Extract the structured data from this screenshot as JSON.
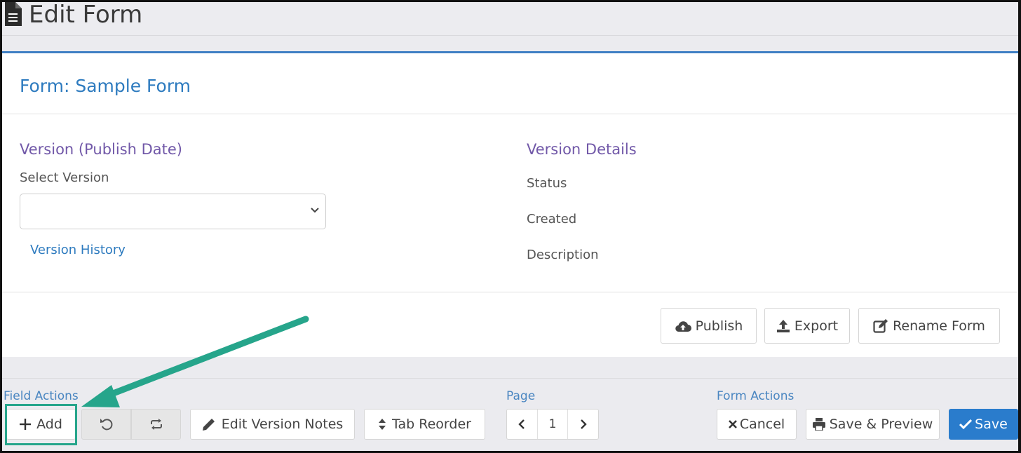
{
  "header": {
    "title": "Edit Form",
    "icon": "document-icon"
  },
  "form": {
    "title": "Form: Sample Form"
  },
  "version": {
    "section_title": "Version (Publish Date)",
    "select_label": "Select Version",
    "select_value": "",
    "history_link": "Version History"
  },
  "details": {
    "section_title": "Version Details",
    "fields": [
      "Status",
      "Created",
      "Description"
    ]
  },
  "card_actions": {
    "publish": "Publish",
    "export": "Export",
    "rename": "Rename Form"
  },
  "toolbar": {
    "field_actions_label": "Field Actions",
    "add": "Add",
    "undo_icon": "undo-icon",
    "redo_icon": "redo-icon",
    "edit_notes": "Edit Version Notes",
    "tab_reorder": "Tab Reorder",
    "page_label": "Page",
    "page_number": "1",
    "form_actions_label": "Form Actions",
    "cancel": "Cancel",
    "save_preview": "Save & Preview",
    "save": "Save"
  },
  "colors": {
    "accent_blue": "#2e7bbf",
    "section_purple": "#7158a8",
    "primary_button": "#2a7ccc",
    "annotation_green": "#26a58b"
  }
}
